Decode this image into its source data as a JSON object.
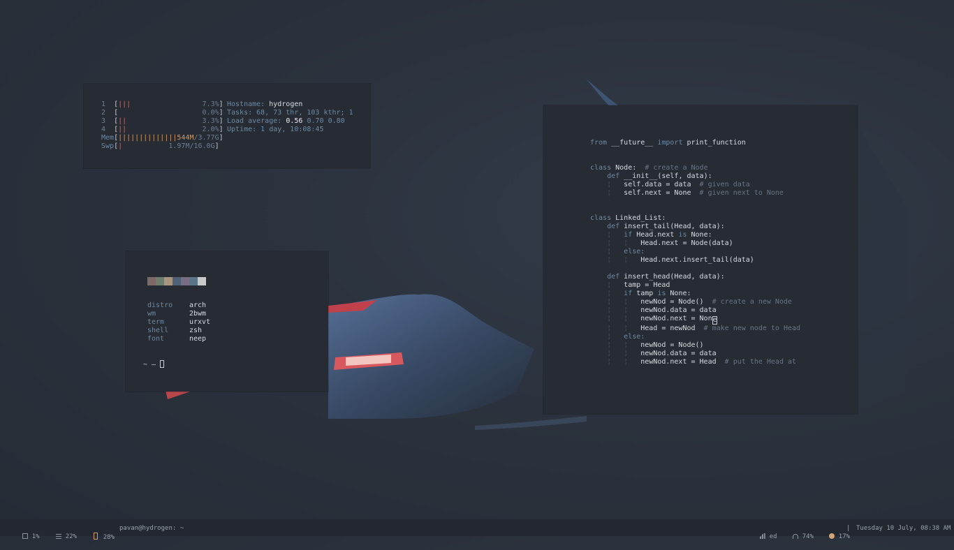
{
  "htop": {
    "cpus": [
      {
        "num": "1",
        "bars": "|||",
        "pct": "7.3%"
      },
      {
        "num": "2",
        "bars": "",
        "pct": "0.0%"
      },
      {
        "num": "3",
        "bars": "||",
        "pct": "3.3%"
      },
      {
        "num": "4",
        "bars": "||",
        "pct": "2.0%"
      }
    ],
    "mem": {
      "label": "Mem",
      "bars": "||||||||||||||",
      "used": "544M",
      "total": "/3.77G"
    },
    "swp": {
      "label": "Swp",
      "bars": "|",
      "used": "1.97M",
      "total": "/16.0G"
    },
    "info": {
      "hostname_label": "Hostname:",
      "hostname": "hydrogen",
      "tasks": "Tasks: 68, 73 thr, 103 kthr; 1",
      "load_label": "Load average:",
      "load1": "0.56",
      "load5": "0.70",
      "load15": "0.80",
      "uptime": "Uptime: 1 day, 10:08:45"
    }
  },
  "neofetch": {
    "palette": [
      "#7d6a68",
      "#6f7d6f",
      "#a9957f",
      "#4e6177",
      "#786d82",
      "#5a7587",
      "#c9c9c9"
    ],
    "rows": [
      {
        "key": "distro",
        "value": "arch"
      },
      {
        "key": "wm",
        "value": "2bwm"
      },
      {
        "key": "term",
        "value": "urxvt"
      },
      {
        "key": "shell",
        "value": "zsh"
      },
      {
        "key": "font",
        "value": "neep"
      }
    ],
    "prompt": "~ —"
  },
  "editor": {
    "lines": [
      {
        "segs": [
          {
            "t": "from",
            "c": "kw"
          },
          {
            "t": " __future__ ",
            "c": "tx"
          },
          {
            "t": "import",
            "c": "kw"
          },
          {
            "t": " print_function",
            "c": "tx"
          }
        ]
      },
      {
        "segs": []
      },
      {
        "segs": []
      },
      {
        "segs": [
          {
            "t": "class",
            "c": "kw"
          },
          {
            "t": " Node:  ",
            "c": "tx"
          },
          {
            "t": "# create a Node",
            "c": "cm"
          }
        ]
      },
      {
        "segs": [
          {
            "t": "    def",
            "c": "kw"
          },
          {
            "t": " __init__(self, data):",
            "c": "tx"
          }
        ]
      },
      {
        "segs": [
          {
            "t": "    ¦   ",
            "c": "guide"
          },
          {
            "t": "self.data = data  ",
            "c": "tx"
          },
          {
            "t": "# given data",
            "c": "cm"
          }
        ]
      },
      {
        "segs": [
          {
            "t": "    ¦   ",
            "c": "guide"
          },
          {
            "t": "self.next = None  ",
            "c": "tx"
          },
          {
            "t": "# given next to None",
            "c": "cm"
          }
        ]
      },
      {
        "segs": []
      },
      {
        "segs": []
      },
      {
        "segs": [
          {
            "t": "class",
            "c": "kw"
          },
          {
            "t": " Linked_List:",
            "c": "tx"
          }
        ]
      },
      {
        "segs": [
          {
            "t": "    def",
            "c": "kw"
          },
          {
            "t": " insert_tail(Head, data):",
            "c": "tx"
          }
        ]
      },
      {
        "segs": [
          {
            "t": "    ¦   ",
            "c": "guide"
          },
          {
            "t": "if",
            "c": "kw"
          },
          {
            "t": " Head.next ",
            "c": "tx"
          },
          {
            "t": "is",
            "c": "kw"
          },
          {
            "t": " None:",
            "c": "tx"
          }
        ]
      },
      {
        "segs": [
          {
            "t": "    ¦   ¦   ",
            "c": "guide"
          },
          {
            "t": "Head.next = Node(data)",
            "c": "tx"
          }
        ]
      },
      {
        "segs": [
          {
            "t": "    ¦   ",
            "c": "guide"
          },
          {
            "t": "else:",
            "c": "kw"
          }
        ]
      },
      {
        "segs": [
          {
            "t": "    ¦   ¦   ",
            "c": "guide"
          },
          {
            "t": "Head.next.insert_tail(data)",
            "c": "tx"
          }
        ]
      },
      {
        "segs": []
      },
      {
        "segs": [
          {
            "t": "    def",
            "c": "kw"
          },
          {
            "t": " insert_head(Head, data):",
            "c": "tx"
          }
        ]
      },
      {
        "segs": [
          {
            "t": "    ¦   ",
            "c": "guide"
          },
          {
            "t": "tamp = Head",
            "c": "tx"
          }
        ]
      },
      {
        "segs": [
          {
            "t": "    ¦   ",
            "c": "guide"
          },
          {
            "t": "if",
            "c": "kw"
          },
          {
            "t": " tamp ",
            "c": "tx"
          },
          {
            "t": "is",
            "c": "kw"
          },
          {
            "t": " None:",
            "c": "tx"
          }
        ]
      },
      {
        "segs": [
          {
            "t": "    ¦   ¦   ",
            "c": "guide"
          },
          {
            "t": "newNod = Node()  ",
            "c": "tx"
          },
          {
            "t": "# create a new Node",
            "c": "cm"
          }
        ]
      },
      {
        "segs": [
          {
            "t": "    ¦   ¦   ",
            "c": "guide"
          },
          {
            "t": "newNod.data = data",
            "c": "tx"
          }
        ]
      },
      {
        "segs": [
          {
            "t": "    ¦   ¦   ",
            "c": "guide"
          },
          {
            "t": "newNod.next = Non",
            "c": "tx"
          },
          {
            "t": "e",
            "c": "cursor"
          }
        ]
      },
      {
        "segs": [
          {
            "t": "    ¦   ¦   ",
            "c": "guide"
          },
          {
            "t": "Head = newNod  ",
            "c": "tx"
          },
          {
            "t": "# make new node to Head",
            "c": "cm"
          }
        ]
      },
      {
        "segs": [
          {
            "t": "    ¦   ",
            "c": "guide"
          },
          {
            "t": "else:",
            "c": "kw"
          }
        ]
      },
      {
        "segs": [
          {
            "t": "    ¦   ¦   ",
            "c": "guide"
          },
          {
            "t": "newNod = Node()",
            "c": "tx"
          }
        ]
      },
      {
        "segs": [
          {
            "t": "    ¦   ¦   ",
            "c": "guide"
          },
          {
            "t": "newNod.data = data",
            "c": "tx"
          }
        ]
      },
      {
        "segs": [
          {
            "t": "    ¦   ¦   ",
            "c": "guide"
          },
          {
            "t": "newNod.next = Head  ",
            "c": "tx"
          },
          {
            "t": "# put the Head at",
            "c": "cm"
          }
        ]
      }
    ]
  },
  "statusbar": {
    "cpu": "1%",
    "mem": "22%",
    "battery": "28%",
    "title": "pavan@hydrogen: ~",
    "workspace": "ed",
    "volume": "74%",
    "brightness": "17%",
    "datetime": "Tuesday 10 July, 08:38 AM"
  },
  "colors": {
    "accent_orange": "#d19a66",
    "bar_red": "#c56a6a",
    "bar_green": "#8aa070"
  }
}
